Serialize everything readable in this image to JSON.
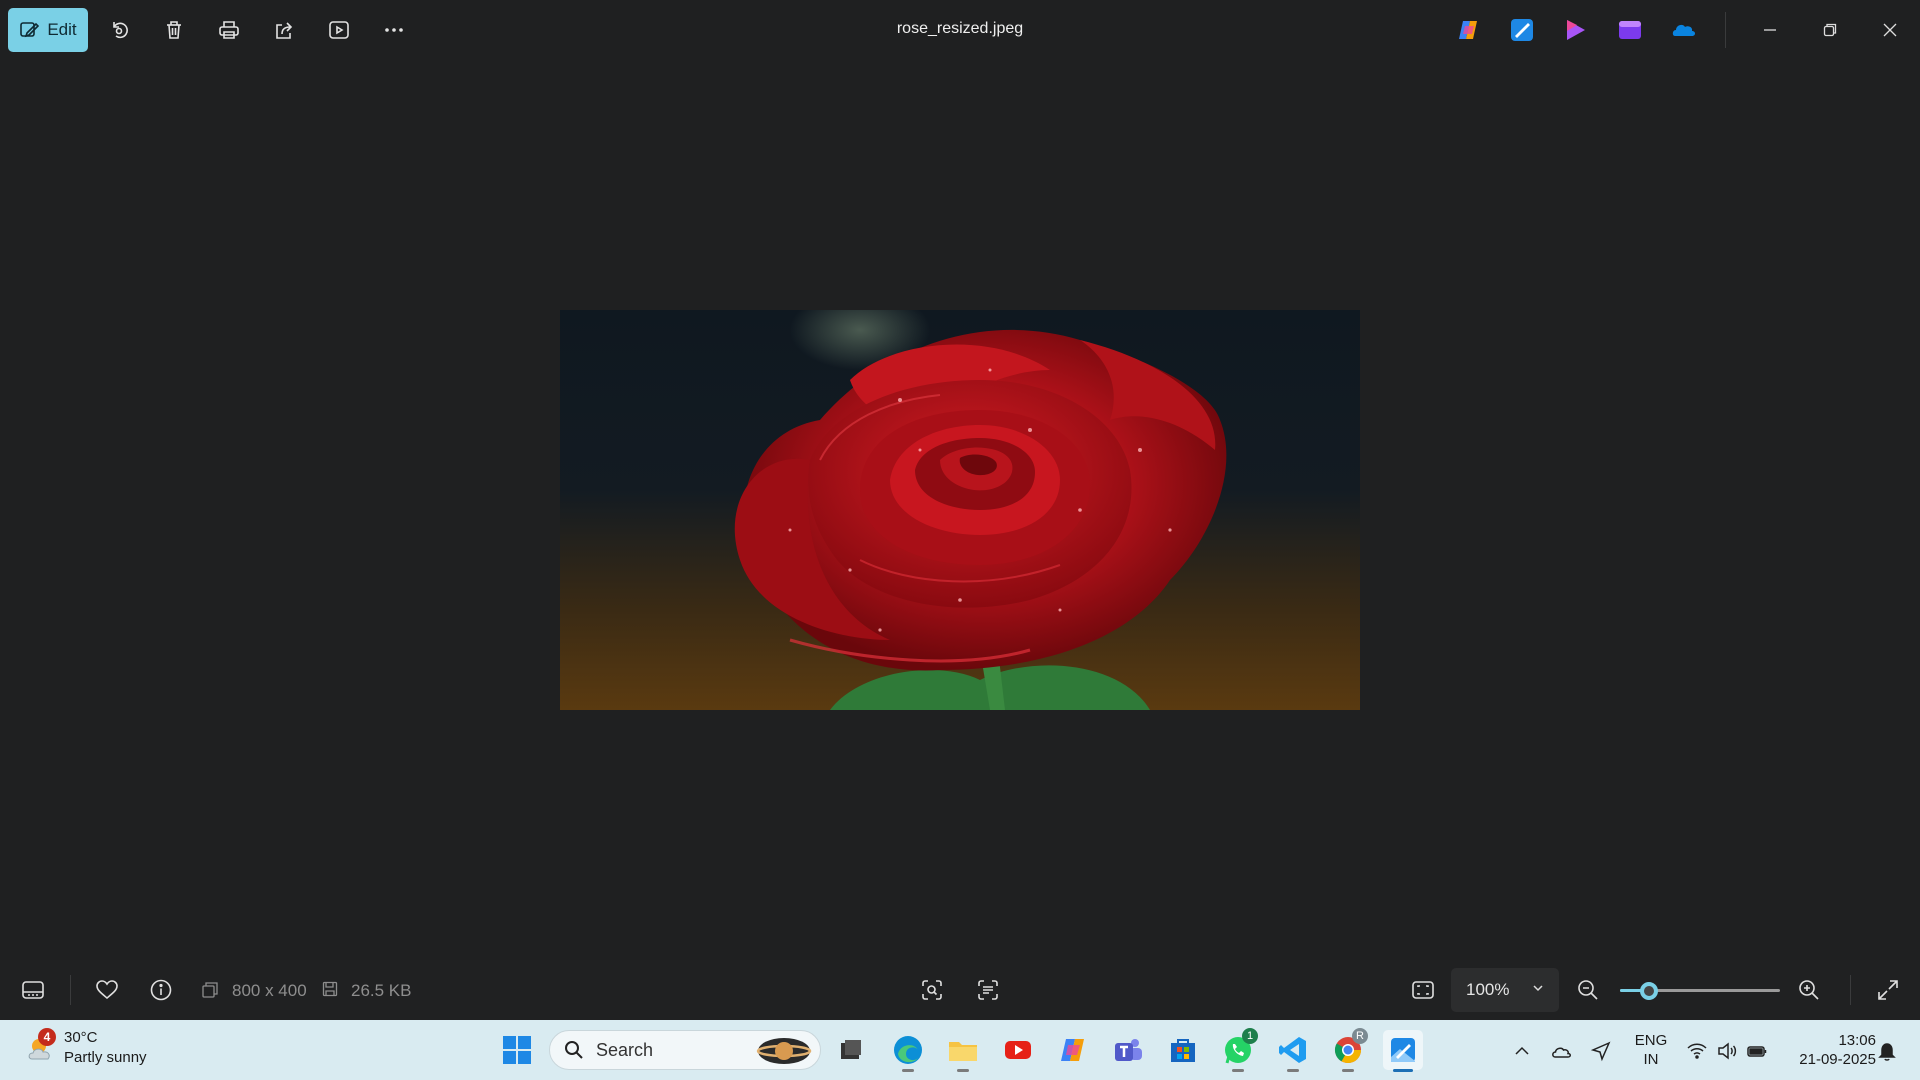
{
  "toolbar": {
    "edit_label": "Edit",
    "file_title": "rose_resized.jpeg",
    "tools": [
      "rotate-icon",
      "delete-icon",
      "print-icon",
      "share-icon",
      "slideshow-icon",
      "more-icon"
    ],
    "right_apps": [
      "copilot-icon",
      "photos-editor-icon",
      "clipchamp-icon",
      "designer-icon",
      "onedrive-icon"
    ]
  },
  "image": {
    "alt": "Red rose with water droplets"
  },
  "status": {
    "dimensions": "800 x 400",
    "file_size": "26.5 KB",
    "zoom": "100%",
    "zoom_level": 0.18
  },
  "taskbar": {
    "weather": {
      "temp": "30°C",
      "condition": "Partly sunny",
      "badge": "4"
    },
    "search_placeholder": "Search",
    "whatsapp_badge": "1",
    "chrome_badge": "R",
    "language": "ENG",
    "region": "IN",
    "time": "13:06",
    "date": "21-09-2025"
  },
  "colors": {
    "accent": "#7ad0e6",
    "background": "#1f2021",
    "taskbar": "#d9ebf1"
  }
}
